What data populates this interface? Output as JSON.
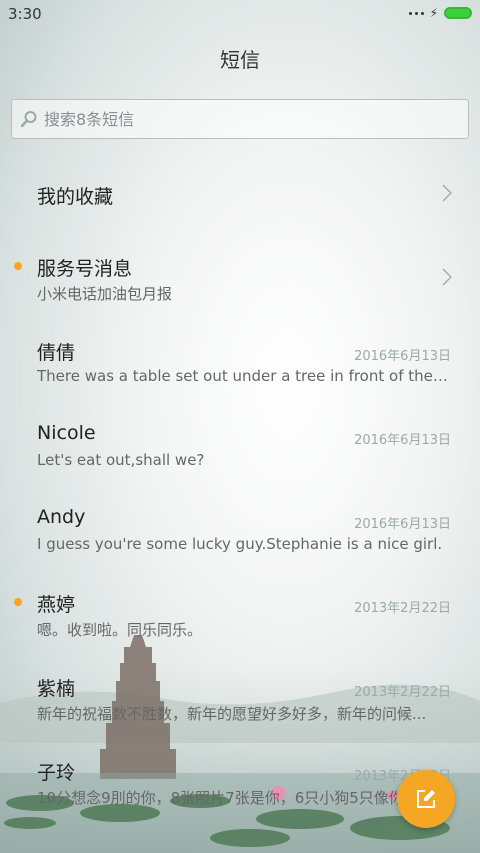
{
  "status": {
    "time": "3:30"
  },
  "header": {
    "title": "短信"
  },
  "search": {
    "placeholder": "搜索8条短信"
  },
  "favorites": {
    "label": "我的收藏"
  },
  "service": {
    "label": "服务号消息",
    "preview": "小米电话加油包月报",
    "unread": true
  },
  "conversations": [
    {
      "name": "倩倩",
      "date": "2016年6月13日",
      "preview": "There was a table set out under a tree in front of the ho...",
      "unread": false
    },
    {
      "name": "Nicole",
      "date": "2016年6月13日",
      "preview": "Let's eat out,shall we?",
      "unread": false
    },
    {
      "name": "Andy",
      "date": "2016年6月13日",
      "preview": "I guess you're some lucky guy.Stephanie is a nice girl.",
      "unread": false
    },
    {
      "name": "燕婷",
      "date": "2013年2月22日",
      "preview": "嗯。收到啦。同乐同乐。",
      "unread": true
    },
    {
      "name": "紫楠",
      "date": "2013年2月22日",
      "preview": "新年的祝福数不胜数，新年的愿望好多好多，新年的问候...",
      "unread": false
    },
    {
      "name": "子玲",
      "date": "2013年2月22日",
      "preview": "10分想念9刖的你，8张照片7张是你，6只小狗5只像你",
      "unread": false
    }
  ],
  "colors": {
    "accent": "#f5a623",
    "battery": "#3ad13a"
  },
  "icons": {
    "search": "search-icon",
    "chevron": "chevron-right-icon",
    "compose": "compose-icon"
  }
}
